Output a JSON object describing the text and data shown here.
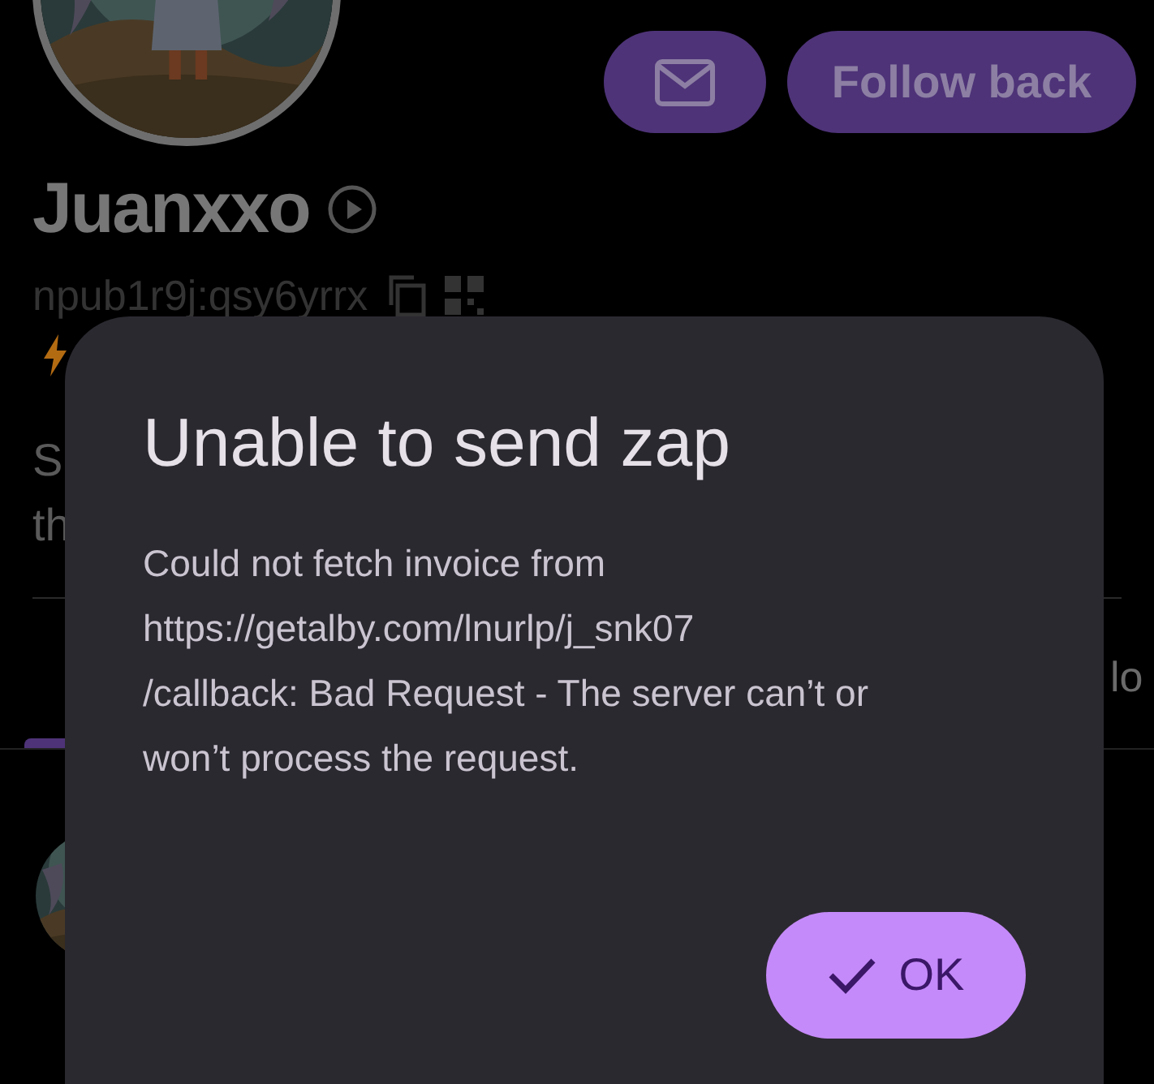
{
  "profile": {
    "name": "Juanxxo",
    "npub": "npub1r9j:qsy6yrrx",
    "about_lines": [
      "S",
      "th"
    ],
    "tab_fragment": "lo"
  },
  "actions": {
    "follow_button": "Follow back"
  },
  "dialog": {
    "title": "Unable to send zap",
    "body": "Could not fetch invoice from\nhttps://getalby.com/lnurlp/j_snk07\n/callback: Bad Request - The server can’t or\nwon’t process the request.",
    "confirm": "OK"
  }
}
